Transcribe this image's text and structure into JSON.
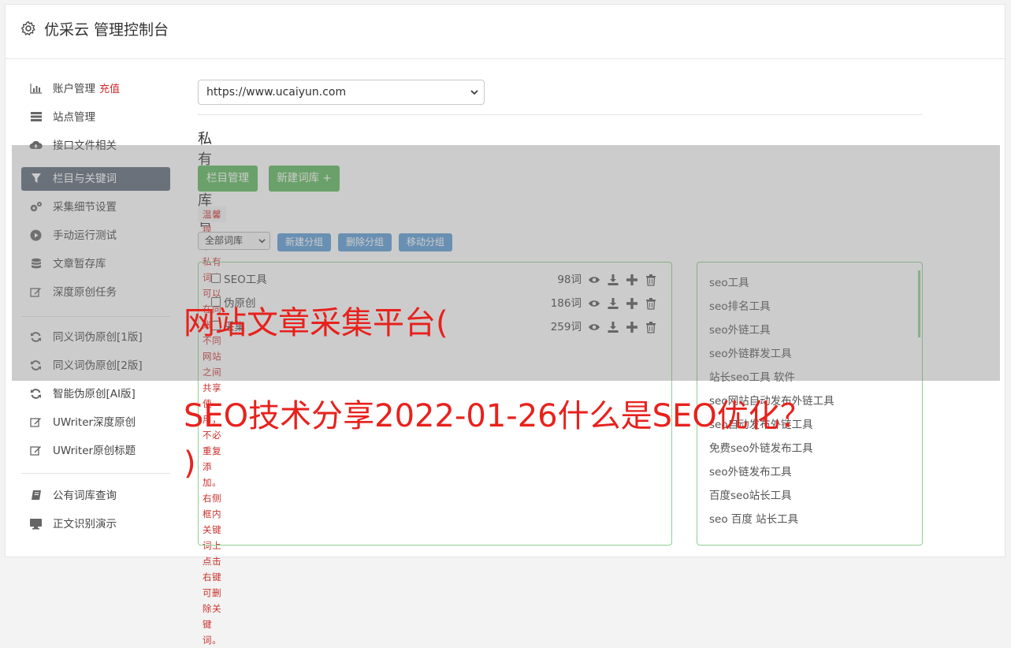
{
  "header": {
    "title": "优采云 管理控制台",
    "icon": "gear-icon"
  },
  "sidebar": {
    "items": [
      {
        "label": "账户管理",
        "badge": "充值",
        "icon": "bar-chart-icon"
      },
      {
        "label": "站点管理",
        "icon": "server-icon"
      },
      {
        "label": "接口文件相关",
        "icon": "cloud-upload-icon"
      },
      {
        "label": "栏目与关键词",
        "icon": "filter-icon",
        "active": true
      },
      {
        "label": "采集细节设置",
        "icon": "gears-icon"
      },
      {
        "label": "手动运行测试",
        "icon": "play-circle-icon"
      },
      {
        "label": "文章暂存库",
        "icon": "database-icon"
      },
      {
        "label": "深度原创任务",
        "icon": "edit-icon"
      },
      {
        "label": "同义词伪原创[1版]",
        "icon": "refresh-icon"
      },
      {
        "label": "同义词伪原创[2版]",
        "icon": "refresh-icon"
      },
      {
        "label": "智能伪原创[AI版]",
        "icon": "refresh-icon"
      },
      {
        "label": "UWriter深度原创",
        "icon": "edit-icon"
      },
      {
        "label": "UWriter原创标题",
        "icon": "edit-icon"
      },
      {
        "label": "公有词库查询",
        "icon": "book-icon"
      },
      {
        "label": "正文识别演示",
        "icon": "monitor-icon"
      }
    ]
  },
  "main": {
    "site_select": {
      "value": "https://www.ucaiyun.com"
    },
    "section_title": "私有词库管理",
    "buttons": {
      "category": "栏目管理",
      "new_library": "新建词库 +"
    },
    "tip": "温馨提示：私有词库可以在同账号不同网站之间共享使用，不必重复添加。右侧框内关键词上点击右键可删除关键词。",
    "filter": {
      "value": "全部词库"
    },
    "group_buttons": {
      "new": "新建分组",
      "delete": "删除分组",
      "move": "移动分组"
    },
    "libraries": [
      {
        "name": "SEO工具",
        "count": "98词"
      },
      {
        "name": "伪原创",
        "count": "186词"
      },
      {
        "name": "采集",
        "count": "259词"
      }
    ],
    "keywords": [
      "seo工具",
      "seo排名工具",
      "seo外链工具",
      "seo外链群发工具",
      "站长seo工具 软件",
      "seo网站自动发布外链工具",
      "seo自动发布外链工具",
      "免费seo外链发布工具",
      "seo外链发布工具",
      "百度seo站长工具",
      "seo 百度 站长工具"
    ]
  },
  "overlay": {
    "line1": "网站文章采集平台(",
    "line2": "SEO技术分享2022-01-26什么是SEO优化？",
    "line3": ")"
  },
  "colors": {
    "active_nav": "#5d6878",
    "green": "#5cb85c",
    "blue": "#5b9bd5",
    "badge_red": "#d12b2b",
    "headline_red": "#e8211c"
  }
}
